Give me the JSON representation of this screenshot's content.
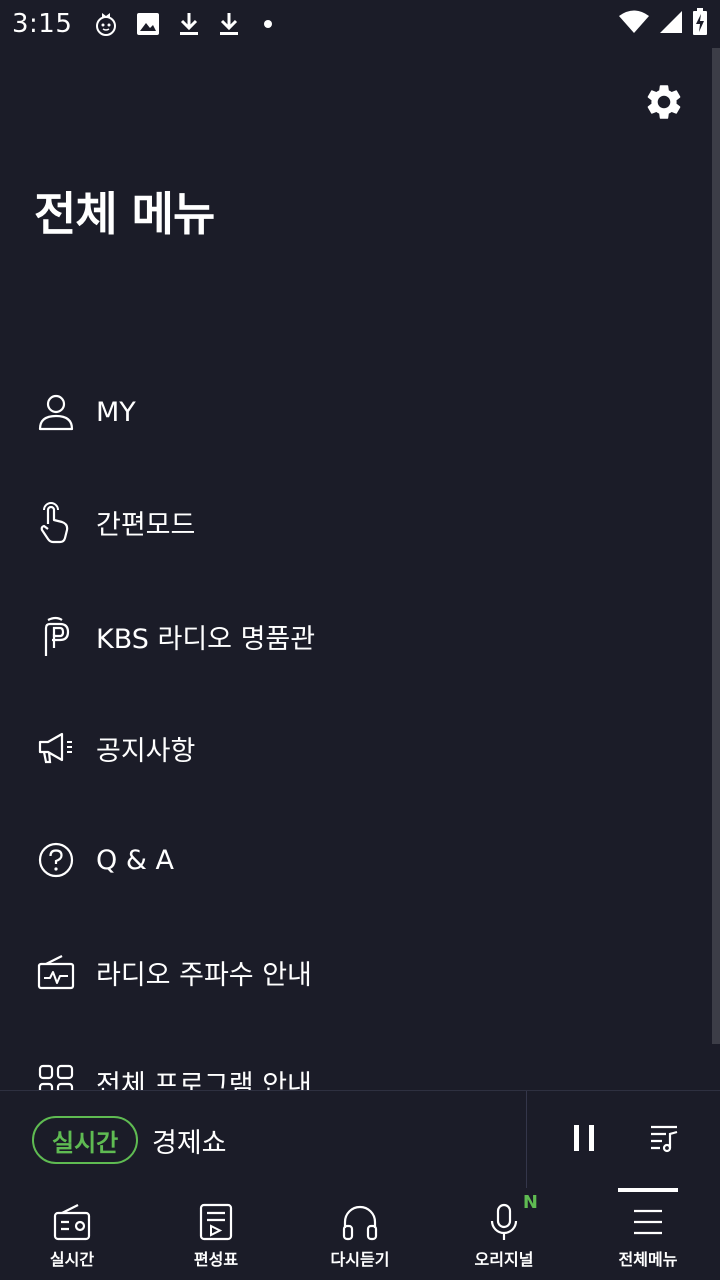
{
  "status_bar": {
    "time": "3:15"
  },
  "header": {
    "title": "전체 메뉴",
    "settings_icon": "gear-icon"
  },
  "menu": {
    "items": [
      {
        "label": "MY",
        "icon": "person-icon"
      },
      {
        "label": "간편모드",
        "icon": "touch-hand-icon"
      },
      {
        "label": "KBS 라디오 명품관",
        "icon": "kbs-premium-logo-icon"
      },
      {
        "label": "공지사항",
        "icon": "megaphone-icon"
      },
      {
        "label": "Q & A",
        "icon": "question-circle-icon"
      },
      {
        "label": "라디오 주파수 안내",
        "icon": "radio-frequency-icon"
      },
      {
        "label": "전체 프로그램 안내",
        "icon": "grid-list-icon"
      }
    ]
  },
  "player": {
    "badge": "실시간",
    "program": "경제쇼"
  },
  "bottom_nav": {
    "items": [
      {
        "label": "실시간",
        "icon": "radio-icon"
      },
      {
        "label": "편성표",
        "icon": "schedule-icon"
      },
      {
        "label": "다시듣기",
        "icon": "headphones-icon"
      },
      {
        "label": "오리지널",
        "icon": "microphone-icon",
        "badge": "N"
      },
      {
        "label": "전체메뉴",
        "icon": "hamburger-menu-icon"
      }
    ],
    "active_index": 4
  },
  "colors": {
    "background": "#1b1c28",
    "accent": "#5fbb52",
    "text": "#ffffff"
  }
}
